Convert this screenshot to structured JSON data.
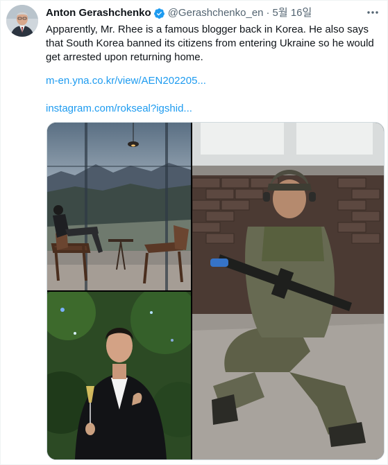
{
  "author": {
    "name": "Anton Gerashchenko",
    "handle": "@Gerashchenko_en",
    "separator": "·",
    "date": "5월 16일",
    "verified_icon": "verified-badge-icon",
    "avatar_icon": "avatar-portrait"
  },
  "tweet": {
    "text": "Apparently, Mr. Rhee is a famous blogger back in Korea. He also says that South Korea banned its citizens from entering Ukraine so he would get arrested upon returning home.",
    "links": [
      "m-en.yna.co.kr/view/AEN202205...",
      "instagram.com/rokseal?igshid..."
    ]
  },
  "media": {
    "photos": [
      {
        "name": "photo-man-seated-by-window"
      },
      {
        "name": "photo-man-in-tuxedo-with-champagne"
      },
      {
        "name": "photo-soldier-seated-with-rifle"
      }
    ]
  },
  "colors": {
    "link": "#1d9bf0",
    "verified": "#1d9bf0",
    "secondary_text": "#536471"
  }
}
